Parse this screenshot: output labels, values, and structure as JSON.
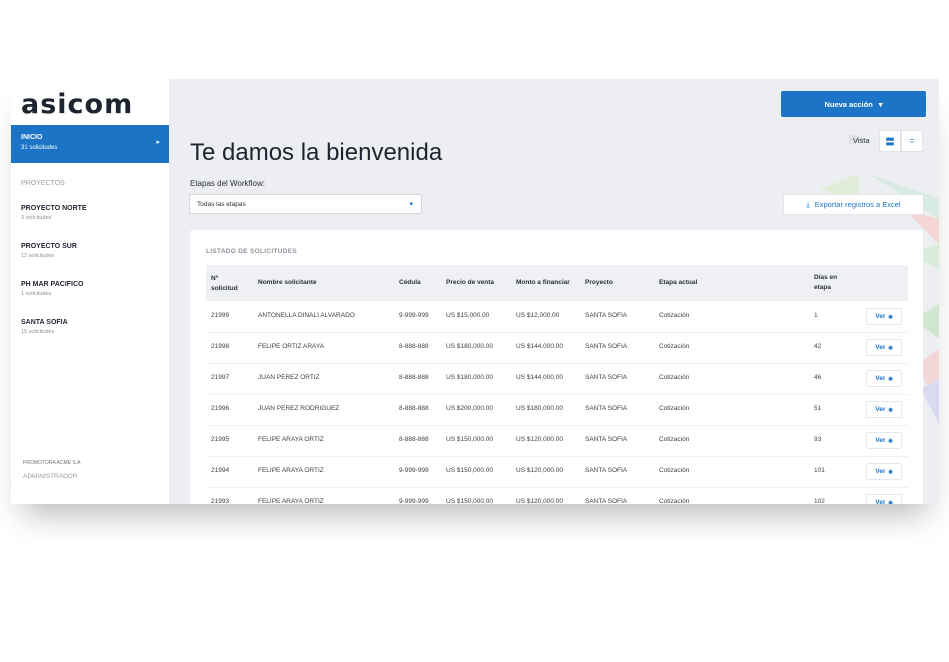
{
  "app": {
    "logo": "asicom"
  },
  "sidebar": {
    "active": {
      "label": "INICIO",
      "count": "31 solicitudes"
    },
    "section_label": "PROYECTOS",
    "projects": [
      {
        "name": "PROYECTO NORTE",
        "count": "3 solicitudes"
      },
      {
        "name": "PROYECTO SUR",
        "count": "12 solicitudes"
      },
      {
        "name": "PH MAR PACIFICO",
        "count": "1 solicitudes"
      },
      {
        "name": "SANTA SOFIA",
        "count": "15 solicitudes"
      }
    ],
    "company": "PROMOTORA ACME S.A",
    "role": "ADMINISTRADOR"
  },
  "header": {
    "new_action_label": "Nueva acción",
    "view_label": "Vista",
    "title": "Te damos la bienvenida",
    "workflow_label": "Etapas del Workflow:",
    "stage_select_value": "Todas las etapas",
    "export_label": "Exportar registros a Excel"
  },
  "table": {
    "section_title": "LISTADO DE SOLICITUDES",
    "columns": [
      "Nº solicitud",
      "Nombre solicitante",
      "Cédula",
      "Precio de venta",
      "Monto a financiar",
      "Proyecto",
      "Etapa actual",
      "Días en etapa"
    ],
    "action_label": "Ver",
    "rows": [
      {
        "id": "21999",
        "name": "ANTONELLA DINALI ALVARADO",
        "cedula": "9-999-999",
        "precio": "US $15,000.00",
        "monto": "US $12,000.00",
        "proyecto": "SANTA SOFIA",
        "etapa": "Cotización",
        "dias": "1"
      },
      {
        "id": "21998",
        "name": "FELIPE ORTIZ ARAYA",
        "cedula": "8-888-888",
        "precio": "US $180,000.00",
        "monto": "US $144,000.00",
        "proyecto": "SANTA SOFIA",
        "etapa": "Cotización",
        "dias": "42"
      },
      {
        "id": "21997",
        "name": "JUAN PEREZ ORTIZ",
        "cedula": "8-888-888",
        "precio": "US $180,000.00",
        "monto": "US $144,000.00",
        "proyecto": "SANTA SOFIA",
        "etapa": "Cotización",
        "dias": "46"
      },
      {
        "id": "21996",
        "name": "JUAN PEREZ RODRIGUEZ",
        "cedula": "8-888-888",
        "precio": "US $200,000.00",
        "monto": "US $180,000.00",
        "proyecto": "SANTA SOFIA",
        "etapa": "Cotización",
        "dias": "51"
      },
      {
        "id": "21995",
        "name": "FELIPE ARAYA ORTIZ",
        "cedula": "8-888-888",
        "precio": "US $150,000.00",
        "monto": "US $120,000.00",
        "proyecto": "SANTA SOFIA",
        "etapa": "Cotización",
        "dias": "93"
      },
      {
        "id": "21994",
        "name": "FELIPE ARAYA ORTIZ",
        "cedula": "9-999-999",
        "precio": "US $150,000.00",
        "monto": "US $120,000.00",
        "proyecto": "SANTA SOFIA",
        "etapa": "Cotización",
        "dias": "101"
      },
      {
        "id": "21993",
        "name": "FELIPE ARAYA ORTIZ",
        "cedula": "9-999-999",
        "precio": "US $150,000.00",
        "monto": "US $120,000.00",
        "proyecto": "SANTA SOFIA",
        "etapa": "Cotización",
        "dias": "102"
      }
    ]
  },
  "colors": {
    "accent": "#1b74c5",
    "sidebar_bg": "#ffffff",
    "content_bg": "#eceef1"
  },
  "icons": {
    "nav_arrow": "chevron-right-icon",
    "dropdown": "caret-down-icon",
    "download": "download-icon",
    "view": "eye-icon"
  }
}
